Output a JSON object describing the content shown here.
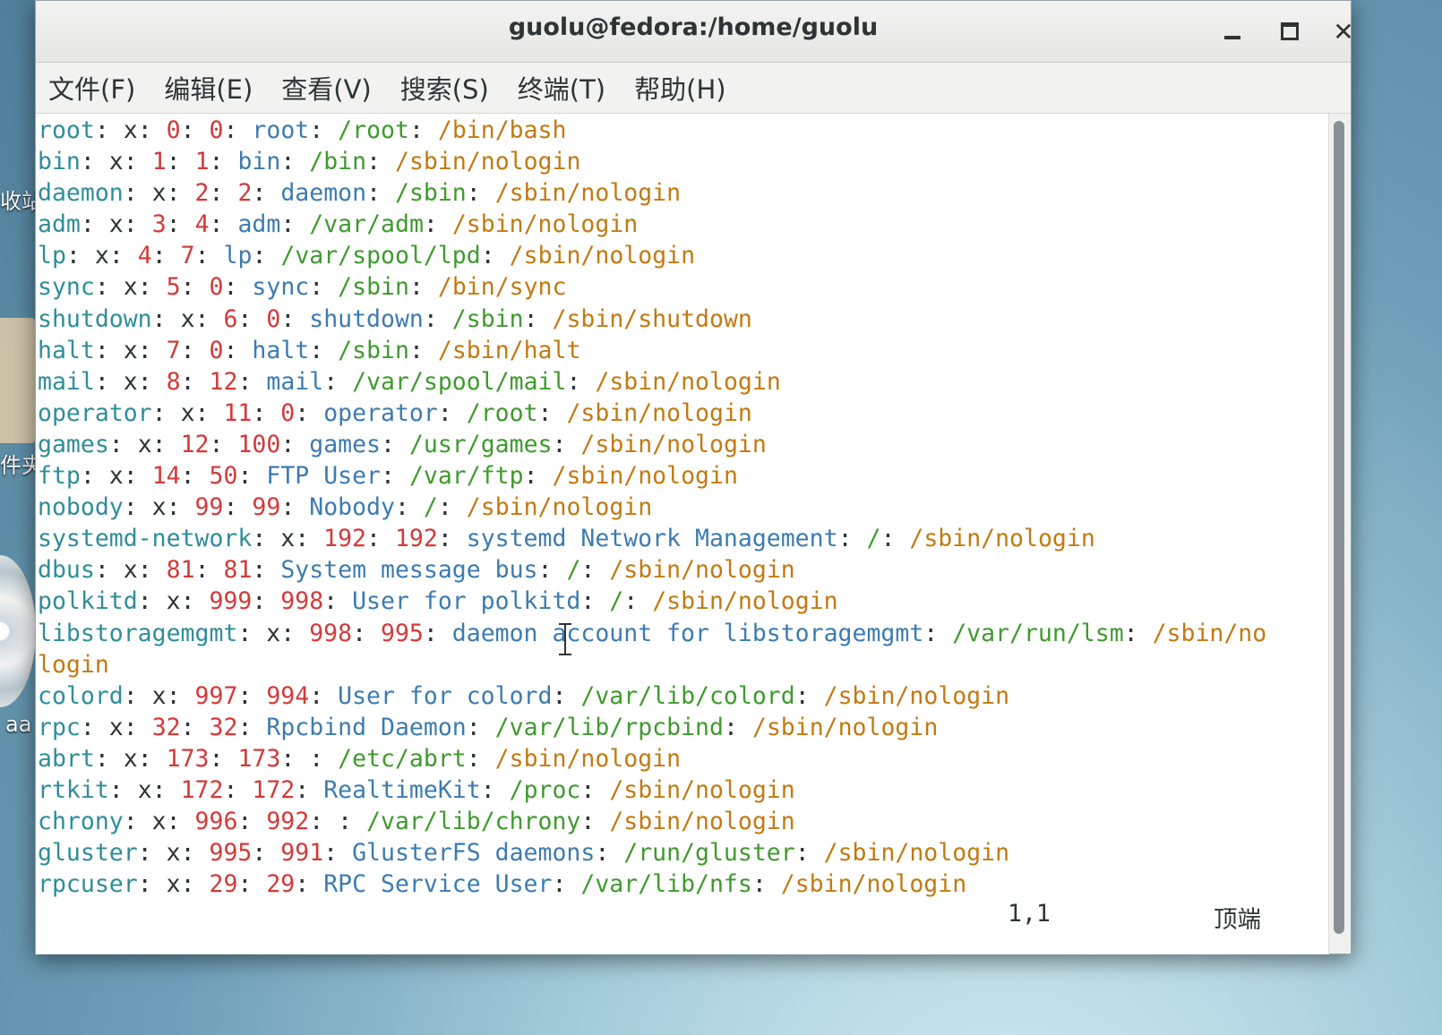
{
  "desktop": {
    "labels": [
      "收站",
      "件夹",
      "aa"
    ]
  },
  "window": {
    "title": "guolu@fedora:/home/guolu",
    "menu": [
      "文件(F)",
      "编辑(E)",
      "查看(V)",
      "搜索(S)",
      "终端(T)",
      "帮助(H)"
    ]
  },
  "terminal": {
    "lines": [
      [
        "root",
        "x",
        "0",
        "0",
        "root",
        "/root",
        "/bin/bash"
      ],
      [
        "bin",
        "x",
        "1",
        "1",
        "bin",
        "/bin",
        "/sbin/nologin"
      ],
      [
        "daemon",
        "x",
        "2",
        "2",
        "daemon",
        "/sbin",
        "/sbin/nologin"
      ],
      [
        "adm",
        "x",
        "3",
        "4",
        "adm",
        "/var/adm",
        "/sbin/nologin"
      ],
      [
        "lp",
        "x",
        "4",
        "7",
        "lp",
        "/var/spool/lpd",
        "/sbin/nologin"
      ],
      [
        "sync",
        "x",
        "5",
        "0",
        "sync",
        "/sbin",
        "/bin/sync"
      ],
      [
        "shutdown",
        "x",
        "6",
        "0",
        "shutdown",
        "/sbin",
        "/sbin/shutdown"
      ],
      [
        "halt",
        "x",
        "7",
        "0",
        "halt",
        "/sbin",
        "/sbin/halt"
      ],
      [
        "mail",
        "x",
        "8",
        "12",
        "mail",
        "/var/spool/mail",
        "/sbin/nologin"
      ],
      [
        "operator",
        "x",
        "11",
        "0",
        "operator",
        "/root",
        "/sbin/nologin"
      ],
      [
        "games",
        "x",
        "12",
        "100",
        "games",
        "/usr/games",
        "/sbin/nologin"
      ],
      [
        "ftp",
        "x",
        "14",
        "50",
        "FTP User",
        "/var/ftp",
        "/sbin/nologin"
      ],
      [
        "nobody",
        "x",
        "99",
        "99",
        "Nobody",
        "/",
        "/sbin/nologin"
      ],
      [
        "systemd-network",
        "x",
        "192",
        "192",
        "systemd Network Management",
        "/",
        "/sbin/nologin"
      ],
      [
        "dbus",
        "x",
        "81",
        "81",
        "System message bus",
        "/",
        "/sbin/nologin"
      ],
      [
        "polkitd",
        "x",
        "999",
        "998",
        "User for polkitd",
        "/",
        "/sbin/nologin"
      ],
      [
        "libstoragemgmt",
        "x",
        "998",
        "995",
        "daemon account for libstoragemgmt",
        "/var/run/lsm",
        "/sbin/no"
      ],
      [
        "login"
      ],
      [
        "colord",
        "x",
        "997",
        "994",
        "User for colord",
        "/var/lib/colord",
        "/sbin/nologin"
      ],
      [
        "rpc",
        "x",
        "32",
        "32",
        "Rpcbind Daemon",
        "/var/lib/rpcbind",
        "/sbin/nologin"
      ],
      [
        "abrt",
        "x",
        "173",
        "173",
        "",
        "/etc/abrt",
        "/sbin/nologin"
      ],
      [
        "rtkit",
        "x",
        "172",
        "172",
        "RealtimeKit",
        "/proc",
        "/sbin/nologin"
      ],
      [
        "chrony",
        "x",
        "996",
        "992",
        "",
        "/var/lib/chrony",
        "/sbin/nologin"
      ],
      [
        "gluster",
        "x",
        "995",
        "991",
        "GlusterFS daemons",
        "/run/gluster",
        "/sbin/nologin"
      ],
      [
        "rpcuser",
        "x",
        "29",
        "29",
        "RPC Service User",
        "/var/lib/nfs",
        "/sbin/nologin"
      ]
    ],
    "status_position": "1,1",
    "status_scroll": "顶端"
  }
}
